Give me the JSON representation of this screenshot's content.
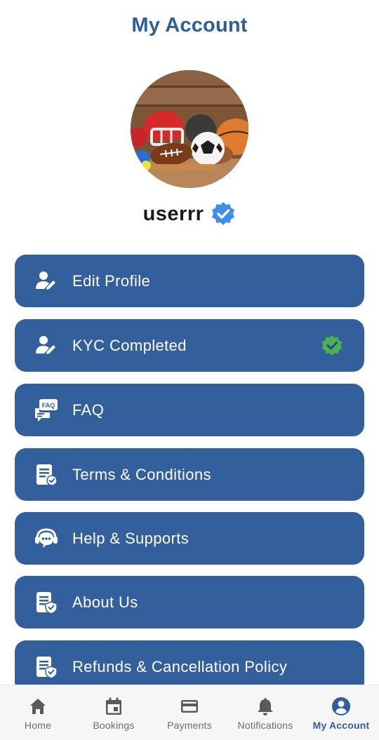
{
  "header": {
    "title": "My Account"
  },
  "profile": {
    "username": "userrr",
    "verified": true
  },
  "menu": [
    {
      "label": "Edit Profile",
      "icon": "edit-profile-icon"
    },
    {
      "label": "KYC Completed",
      "icon": "kyc-icon",
      "status_icon": "kyc-verified-icon"
    },
    {
      "label": "FAQ",
      "icon": "faq-icon"
    },
    {
      "label": "Terms & Conditions",
      "icon": "terms-icon"
    },
    {
      "label": "Help & Supports",
      "icon": "support-icon"
    },
    {
      "label": "About Us",
      "icon": "about-us-icon"
    },
    {
      "label": "Refunds & Cancellation Policy",
      "icon": "refund-policy-icon"
    }
  ],
  "nav": [
    {
      "label": "Home",
      "icon": "home-icon",
      "active": false
    },
    {
      "label": "Bookings",
      "icon": "calendar-icon",
      "active": false
    },
    {
      "label": "Payments",
      "icon": "credit-card-icon",
      "active": false
    },
    {
      "label": "Notifications",
      "icon": "bell-icon",
      "active": false
    },
    {
      "label": "My Account",
      "icon": "account-icon",
      "active": true
    }
  ],
  "colors": {
    "primary": "#33609c",
    "title": "#2f5f98",
    "verified_badge": "#3d8fe8",
    "kyc_badge": "#4caf50",
    "nav_inactive": "#6b6b6b"
  }
}
